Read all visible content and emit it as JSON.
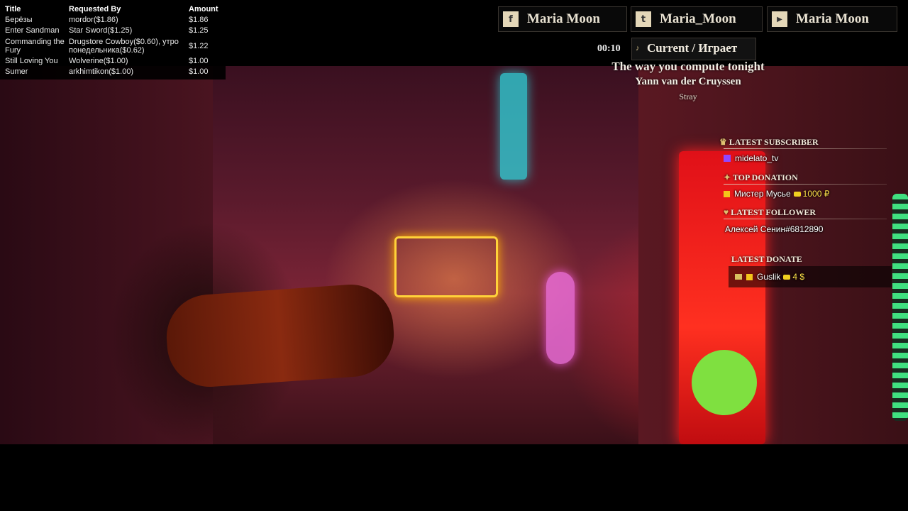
{
  "requests": {
    "headers": {
      "title": "Title",
      "requested_by": "Requested By",
      "amount": "Amount"
    },
    "rows": [
      {
        "title": "Берёзы",
        "by": "mordor($1.86)",
        "amount": "$1.86"
      },
      {
        "title": "Enter Sandman",
        "by": "Star Sword($1.25)",
        "amount": "$1.25"
      },
      {
        "title": "Commanding the Fury",
        "by": "Drugstore Cowboy($0.60), утро понедельника($0.62)",
        "amount": "$1.22"
      },
      {
        "title": "Still Loving You",
        "by": "Wolverine($1.00)",
        "amount": "$1.00"
      },
      {
        "title": "Sumer",
        "by": "arkhimtikon($1.00)",
        "amount": "$1.00"
      }
    ]
  },
  "social": [
    {
      "icon": "facebook-icon",
      "glyph": "f",
      "label": "Maria Moon"
    },
    {
      "icon": "twitter-icon",
      "glyph": "t",
      "label": "Maria_Moon"
    },
    {
      "icon": "youtube-icon",
      "glyph": "▶",
      "label": "Maria Moon"
    }
  ],
  "now_playing": {
    "time": "00:10",
    "label": "Current / Играет",
    "song": "The way you compute tonight",
    "artist": "Yann van der Cruyssen",
    "game": "Stray"
  },
  "stats": {
    "latest_subscriber": {
      "heading": "LATEST SUBSCRIBER",
      "value": "midelato_tv"
    },
    "top_donation": {
      "heading": "TOP DONATION",
      "name": "Мистер Мусье",
      "amount": "1000 ₽"
    },
    "latest_follower": {
      "heading": "LATEST FOLLOWER",
      "value": "Алексей Сенин#6812890"
    },
    "latest_donate": {
      "heading": "LATEST DONATE",
      "name": "Guslik",
      "amount": "4 $"
    }
  },
  "colors": {
    "accent_gold": "#f4c51a",
    "panel_bg": "#0a0a0a"
  }
}
